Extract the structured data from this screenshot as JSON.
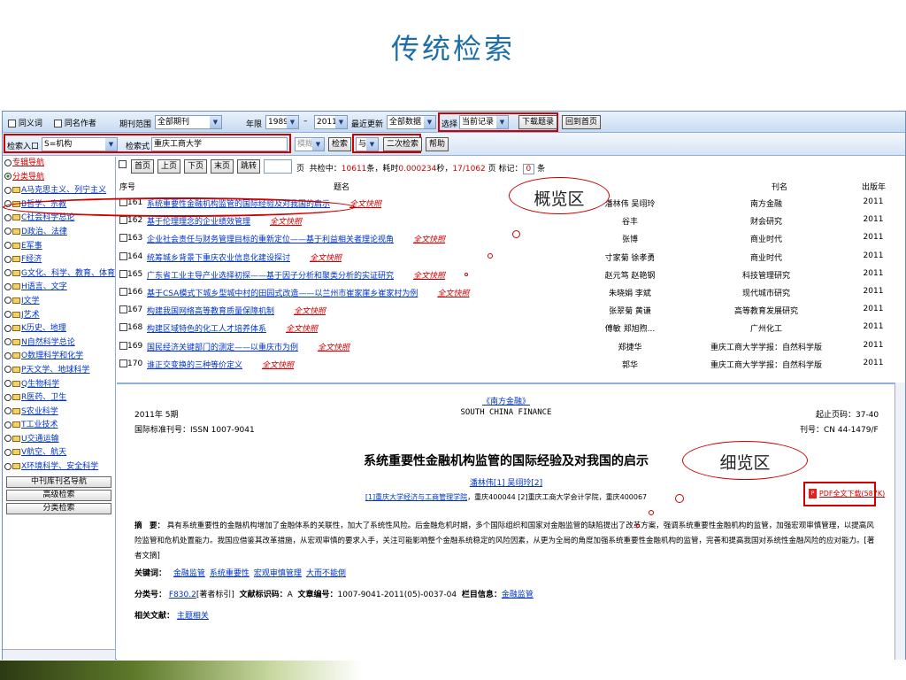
{
  "slide": {
    "title": "传统检索"
  },
  "toolbar1": {
    "synonym_label": "同义词",
    "same_author_label": "同名作者",
    "journal_range_label": "期刊范围",
    "journal_range_value": "全部期刊",
    "year_label": "年限",
    "year_from": "1989",
    "year_dash": "–",
    "year_to": "2011",
    "recent_update_label": "最近更新",
    "recent_update_value": "全部数据",
    "choose_label": "选择",
    "choose_value": "当前记录",
    "download_button": "下载题录",
    "home_button": "回到首页"
  },
  "toolbar2": {
    "entry_label": "检索入口",
    "entry_value": "S=机构",
    "query_label": "检索式",
    "query_value": "重庆工商大学",
    "fuzzy_value": "模糊",
    "search_button": "检索",
    "logic_value": "与",
    "secondary_search_button": "二次检索",
    "help_button": "帮助"
  },
  "sidebar": {
    "items": [
      {
        "label": "专辑导航",
        "type": "radio",
        "color": "#cc0000"
      },
      {
        "label": "分类导航",
        "type": "radio-checked",
        "color": "#cc0000"
      },
      {
        "label": "A马克思主义、列宁主义",
        "type": "folder"
      },
      {
        "label": "B哲学、宗教",
        "type": "folder"
      },
      {
        "label": "C社会科学总论",
        "type": "folder"
      },
      {
        "label": "D政治、法律",
        "type": "folder"
      },
      {
        "label": "E军事",
        "type": "folder"
      },
      {
        "label": "F经济",
        "type": "folder"
      },
      {
        "label": "G文化、科学、教育、体育",
        "type": "folder"
      },
      {
        "label": "H语言、文字",
        "type": "folder"
      },
      {
        "label": "I文学",
        "type": "folder"
      },
      {
        "label": "J艺术",
        "type": "folder"
      },
      {
        "label": "K历史、地理",
        "type": "folder"
      },
      {
        "label": "N自然科学总论",
        "type": "folder"
      },
      {
        "label": "O数理科学和化学",
        "type": "folder"
      },
      {
        "label": "P天文学、地球科学",
        "type": "folder"
      },
      {
        "label": "Q生物科学",
        "type": "folder"
      },
      {
        "label": "R医药、卫生",
        "type": "folder"
      },
      {
        "label": "S农业科学",
        "type": "folder"
      },
      {
        "label": "T工业技术",
        "type": "folder"
      },
      {
        "label": "U交通运输",
        "type": "folder"
      },
      {
        "label": "V航空、航天",
        "type": "folder"
      },
      {
        "label": "X环境科学、安全科学",
        "type": "folder"
      }
    ],
    "buttons": [
      "中刊库刊名导航",
      "高级检索",
      "分类检索"
    ]
  },
  "pager": {
    "first": "首页",
    "prev": "上页",
    "next": "下页",
    "last": "末页",
    "jump": "跳转",
    "page_suffix": "页",
    "status_prefix": "共检中：",
    "count": "10611",
    "status_mid": "条，耗时",
    "time": "0.000234",
    "status_sec": "秒，",
    "page_info": "17/1062",
    "page_info_suffix": "页  标记：",
    "mark_count": "0",
    "mark_suffix": "条"
  },
  "columns": {
    "num": "序号",
    "title": "题名",
    "author": "作者",
    "journal": "刊名",
    "year": "出版年"
  },
  "full_text_label": "全文快照",
  "rows": [
    {
      "num": "161",
      "title": "系统重要性金融机构监管的国际经验及对我国的启示",
      "author": "潘林伟 吴翊玲",
      "journal": "南方金融",
      "year": "2011"
    },
    {
      "num": "162",
      "title": "基于伦理理念的企业绩效管理",
      "author": "谷丰",
      "journal": "财会研究",
      "year": "2011"
    },
    {
      "num": "163",
      "title": "企业社会责任与财务管理目标的重新定位——基于利益相关者理论视角",
      "author": "张博",
      "journal": "商业时代",
      "year": "2011"
    },
    {
      "num": "164",
      "title": "统筹城乡背景下重庆农业信息化建设探讨",
      "author": "寸家菊 徐孝勇",
      "journal": "商业时代",
      "year": "2011"
    },
    {
      "num": "165",
      "title": "广东省工业主导产业选择初探——基于因子分析和聚类分析的实证研究",
      "author": "赵元笃 赵艳钢",
      "journal": "科技管理研究",
      "year": "2011"
    },
    {
      "num": "166",
      "title": "基于CSA模式下城乡型城中村的田园式改造——以兰州市崔家崖乡崔家村为例",
      "author": "朱晓娟 李斌",
      "journal": "现代城市研究",
      "year": "2011"
    },
    {
      "num": "167",
      "title": "构建我国网络高等教育质量保障机制",
      "author": "张翠菊 黄谦",
      "journal": "高等教育发展研究",
      "year": "2011"
    },
    {
      "num": "168",
      "title": "构建区域特色的化工人才培养体系",
      "author": "傅敏 郑旭煦...",
      "journal": "广州化工",
      "year": "2011"
    },
    {
      "num": "169",
      "title": "国民经济关键部门的测定——以重庆市为例",
      "author": "郑捷华",
      "journal": "重庆工商大学学报：自然科学版",
      "year": "2011"
    },
    {
      "num": "170",
      "title": "谁正交变换的三种等价定义",
      "author": "郭华",
      "journal": "重庆工商大学学报：自然科学版",
      "year": "2011"
    }
  ],
  "callouts": {
    "overview": "概览区",
    "detail": "细览区"
  },
  "detail": {
    "journal_cn": "《南方金融》",
    "journal_en": "SOUTH CHINA FINANCE",
    "issue": "2011年 5期",
    "pages": "起止页码：37-40",
    "issn": "国际标准刊号：ISSN 1007-9041",
    "cn": "刊号：CN 44-1479/F",
    "article_title": "系统重要性金融机构监管的国际经验及对我国的启示",
    "authors": "潘林伟[1] 吴翊玲[2]",
    "affil_link": "[1]重庆大学经济与工商管理学院",
    "affil_rest": "，重庆400044 [2]重庆工商大学会计学院，重庆400067",
    "pdf_label": "PDF全文下载(587K)",
    "abstract_label": "摘　要：",
    "abstract": "具有系统重要性的金融机构增加了金融体系的关联性，加大了系统性风险。后金融危机时期，多个国际组织和国家对金融监管的缺陷提出了改革方案，强调系统重要性金融机构的监管，加强宏观审慎管理，以提高风险监管和危机处置能力。我国应借鉴其改革措施，从宏观审慎的要求入手，关注可能影响整个金融系统稳定的风险因素，从更为全局的角度加强系统重要性金融机构的监管，完善和提高我国对系统性金融风险的应对能力。[著者文摘]",
    "keywords_label": "关键词：",
    "keywords": [
      "金融监管",
      "系统重要性",
      "宏观审慎管理",
      "大而不能倒"
    ],
    "class_label": "分类号：",
    "class_link": "F830.2",
    "class_rest": "[著者标引]",
    "doc_code_label": "文献标识码：",
    "doc_code": "A",
    "article_no_label": "文章编号：",
    "article_no": "1007-9041-2011(05)-0037-04",
    "column_label": "栏目信息：",
    "column_link": "金融监管",
    "related_label": "相关文献：",
    "related_link": "主题相关"
  }
}
